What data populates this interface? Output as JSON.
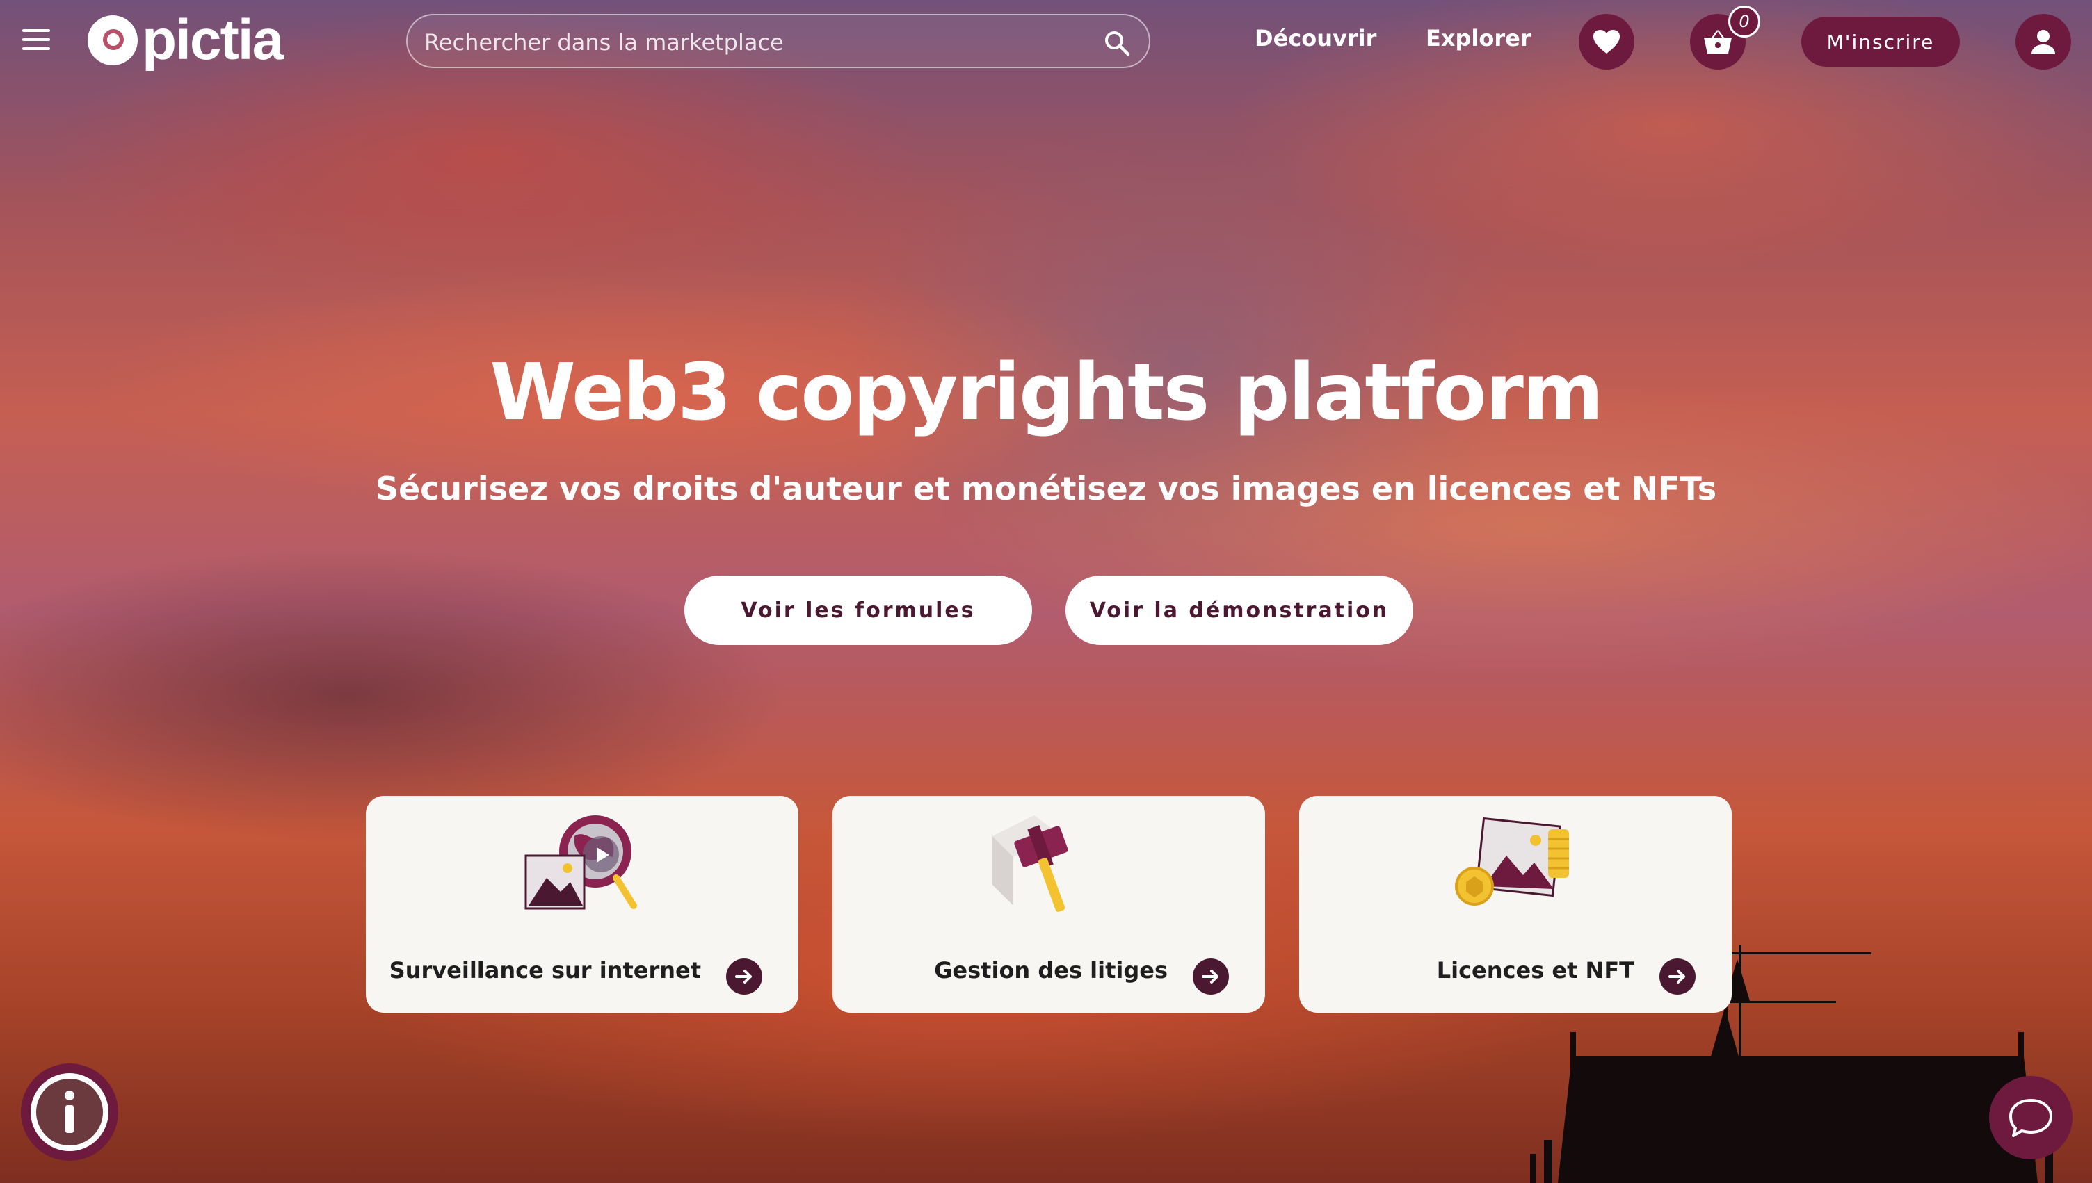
{
  "header": {
    "logo_text": "pictia",
    "search": {
      "placeholder": "Rechercher dans la marketplace"
    },
    "nav": {
      "discover": "Découvrir",
      "explore": "Explorer"
    },
    "cart_count": "0",
    "signup_label": "M'inscrire"
  },
  "hero": {
    "title": "Web3 copyrights platform",
    "subtitle": "Sécurisez vos droits d'auteur et monétisez vos images en licences et NFTs",
    "buttons": [
      {
        "label": "Voir les formules"
      },
      {
        "label": "Voir la démonstration"
      }
    ]
  },
  "cards": [
    {
      "label": "Surveillance sur internet",
      "icon": "magnifier-globe-icon"
    },
    {
      "label": "Gestion des litiges",
      "icon": "gavel-icon"
    },
    {
      "label": "Licences et NFT",
      "icon": "image-coins-icon"
    }
  ],
  "colors": {
    "brand": "#6d1a3e",
    "dark_brand": "#4a1830",
    "card_bg": "#f8f6f2",
    "accent_gold": "#f2c230"
  }
}
